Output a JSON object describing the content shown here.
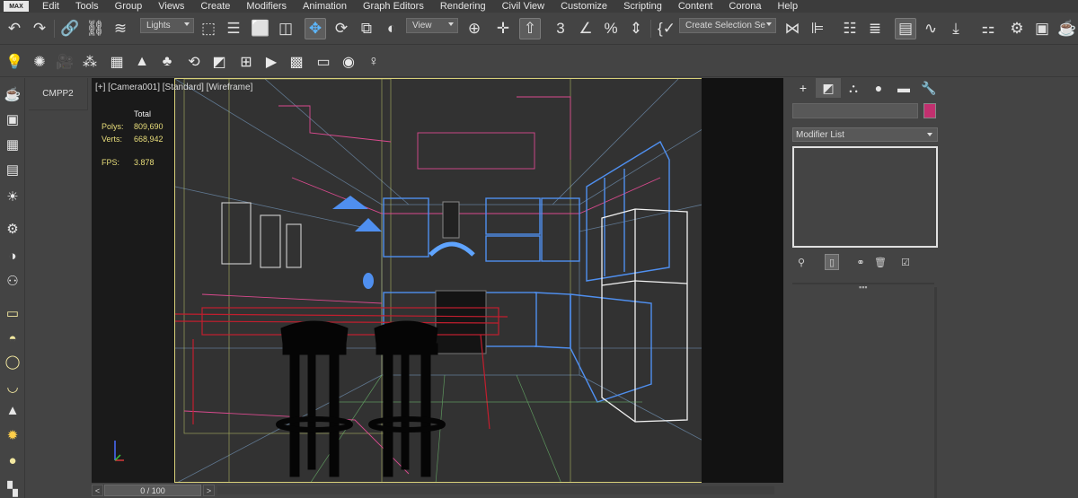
{
  "app": {
    "logo_text": "MAX"
  },
  "menu": [
    "Edit",
    "Tools",
    "Group",
    "Views",
    "Create",
    "Modifiers",
    "Animation",
    "Graph Editors",
    "Rendering",
    "Civil View",
    "Customize",
    "Scripting",
    "Content",
    "Corona",
    "Help"
  ],
  "toolbar": {
    "selection_filter": "Lights",
    "reference_coord": "View",
    "named_selection": "Create Selection Se",
    "angle_snap_label": "3",
    "percent_snap_label": "%"
  },
  "viewport": {
    "label": "[+] [Camera001] [Standard] [Wireframe]",
    "stats": {
      "header": "Total",
      "polys_label": "Polys:",
      "polys_value": "809,690",
      "verts_label": "Verts:",
      "verts_value": "668,942",
      "fps_label": "FPS:",
      "fps_value": "3.878"
    }
  },
  "side_tab": {
    "label": "CMPP2"
  },
  "timeline": {
    "frame_display": "0 / 100",
    "prev": "<",
    "next": ">"
  },
  "command_panel": {
    "tabs": [
      "create-icon",
      "modify-icon",
      "hierarchy-icon",
      "motion-icon",
      "display-icon",
      "utilities-icon"
    ],
    "object_name": "",
    "object_color": "#c2306f",
    "modifier_list_label": "Modifier List"
  }
}
